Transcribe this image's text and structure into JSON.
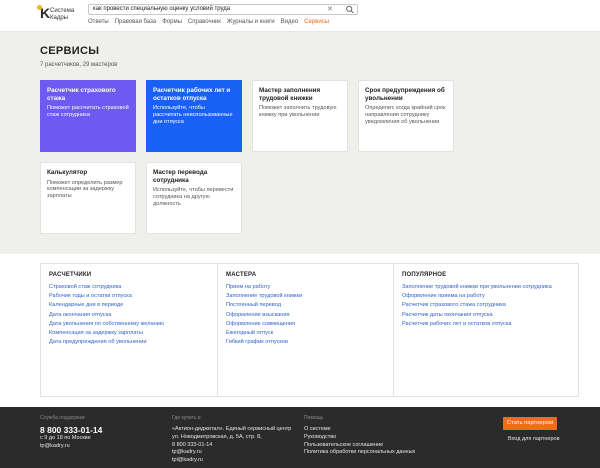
{
  "header": {
    "logo_mark": "K",
    "logo_line1": "Система",
    "logo_line2": "Кадры",
    "search_value": "как провести специальную оценку условий труда",
    "clear_glyph": "✕",
    "nav": [
      "Ответы",
      "Правовая база",
      "Формы",
      "Справочник",
      "Журналы и книги",
      "Видео",
      "Сервисы"
    ],
    "nav_active": "Сервисы"
  },
  "services": {
    "title": "СЕРВИСЫ",
    "subtitle": "7 расчетчиков, 29 мастеров",
    "cards": [
      {
        "title": "Расчетчик страхового стажа",
        "desc": "Поможет рассчитать страховой стаж сотрудника",
        "style": "purple"
      },
      {
        "title": "Расчетчик рабочих лет и остатков отпуска",
        "desc": "Используйте, чтобы рассчитать неиспользованные дни отпуска",
        "style": "blue"
      },
      {
        "title": "Мастер заполнения трудовой книжки",
        "desc": "Поможет заполнить трудовую книжку при увольнении",
        "style": "white"
      },
      {
        "title": "Срок предупреждения об увольнении",
        "desc": "Определит, когда крайний срок направления сотруднику уведомления об увольнении",
        "style": "white"
      },
      {
        "title": "Калькулятор",
        "desc": "Поможет определить размер компенсации за задержку зарплаты",
        "style": "white"
      },
      {
        "title": "Мастер перевода сотрудника",
        "desc": "Используйте, чтобы перевести сотрудника на другую должность",
        "style": "white"
      }
    ],
    "colors": {
      "purple": "#6e59f2",
      "blue": "#1961f5",
      "accent": "#f26b1f",
      "link": "#2f62c9"
    }
  },
  "lists": [
    {
      "title": "РАСЧЕТЧИКИ",
      "links": [
        "Страховой стаж сотрудника",
        "Рабочие годы и остатки отпуска",
        "Календарные дни в периоде",
        "Дата окончания отпуска",
        "Дата увольнения по собственному желанию",
        "Компенсация за задержку зарплаты",
        "Дата предупреждения об увольнении"
      ]
    },
    {
      "title": "МАСТЕРА",
      "links": [
        "Прием на работу",
        "Заполнение трудовой книжки",
        "Постоянный перевод",
        "Оформление взыскания",
        "Оформление совмещения",
        "Ежегодный отпуск",
        "Гибкий график отпусков"
      ]
    },
    {
      "title": "ПОПУЛЯРНОЕ",
      "links": [
        "Заполнение трудовой книжки при увольнении сотрудника",
        "Оформление приема на работу",
        "Расчетчик страхового стажа сотрудника",
        "Расчетчик даты окончания отпуска",
        "Расчетчик рабочих лет и остатков отпуска"
      ]
    }
  ],
  "footer": {
    "support_label": "Служба поддержки",
    "support_phone": "8 800 333-01-14",
    "support_hours": "с 9 до 18 по Москве",
    "support_email": "tp@kadry.ru",
    "buy_label": "Где купить в",
    "buy_line1": "«Актион-диджитал». Единый сервисный центр",
    "buy_line2": "ул. Новодмитровская, д. 5А, стр. 8,",
    "buy_line3": "8 800 333-01-14",
    "buy_line4": "tp@kadry.ru",
    "buy_line5": "tpl@kadry.ru",
    "help_label": "Помощь",
    "help_links": [
      "О системе",
      "Руководство",
      "Пользовательское соглашение",
      "Политика обработки персональных данных"
    ],
    "partner_button": "Стать партнером",
    "partner_login": "Вход для партнеров"
  }
}
